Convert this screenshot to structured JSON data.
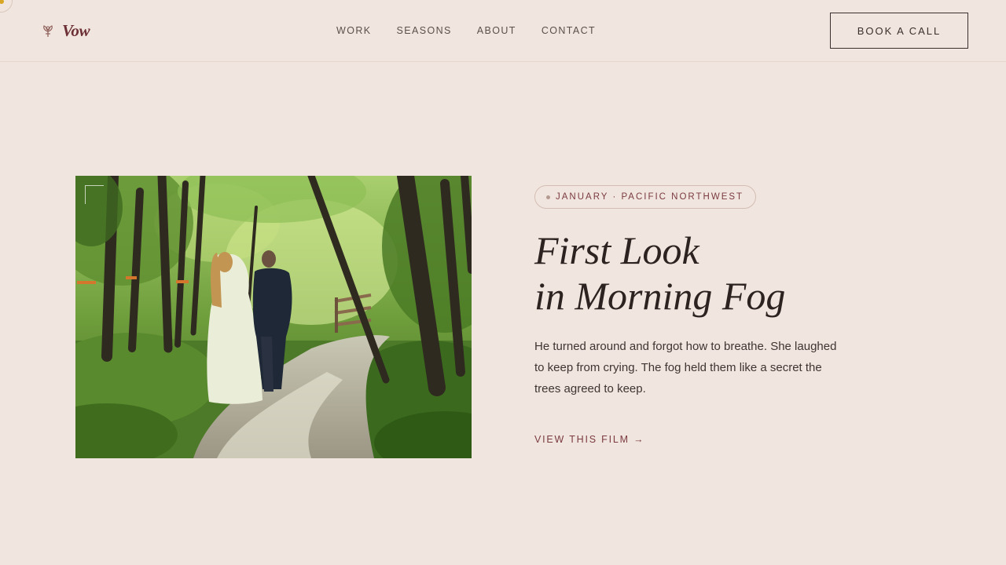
{
  "brand": {
    "name": "Vow",
    "logo_icon": "bouquet-icon"
  },
  "nav": {
    "items": [
      {
        "label": "WORK"
      },
      {
        "label": "SEASONS"
      },
      {
        "label": "ABOUT"
      },
      {
        "label": "CONTACT"
      }
    ]
  },
  "header": {
    "cta_label": "BOOK A CALL"
  },
  "feature": {
    "tag": "JANUARY · PACIFIC NORTHWEST",
    "title_line1": "First Look",
    "title_line2": "in Morning Fog",
    "description": "He turned around and forgot how to breathe. She laughed to keep from crying. The fog held them like a secret the trees agreed to keep.",
    "link_label": "VIEW THIS FILM →",
    "image_subject": "couple-walking-forest-path"
  },
  "colors": {
    "background": "#f1e6df",
    "accent": "#7a3a40",
    "brand": "#6b2f35",
    "text": "#2c2220",
    "indicator": "#d9a624"
  }
}
